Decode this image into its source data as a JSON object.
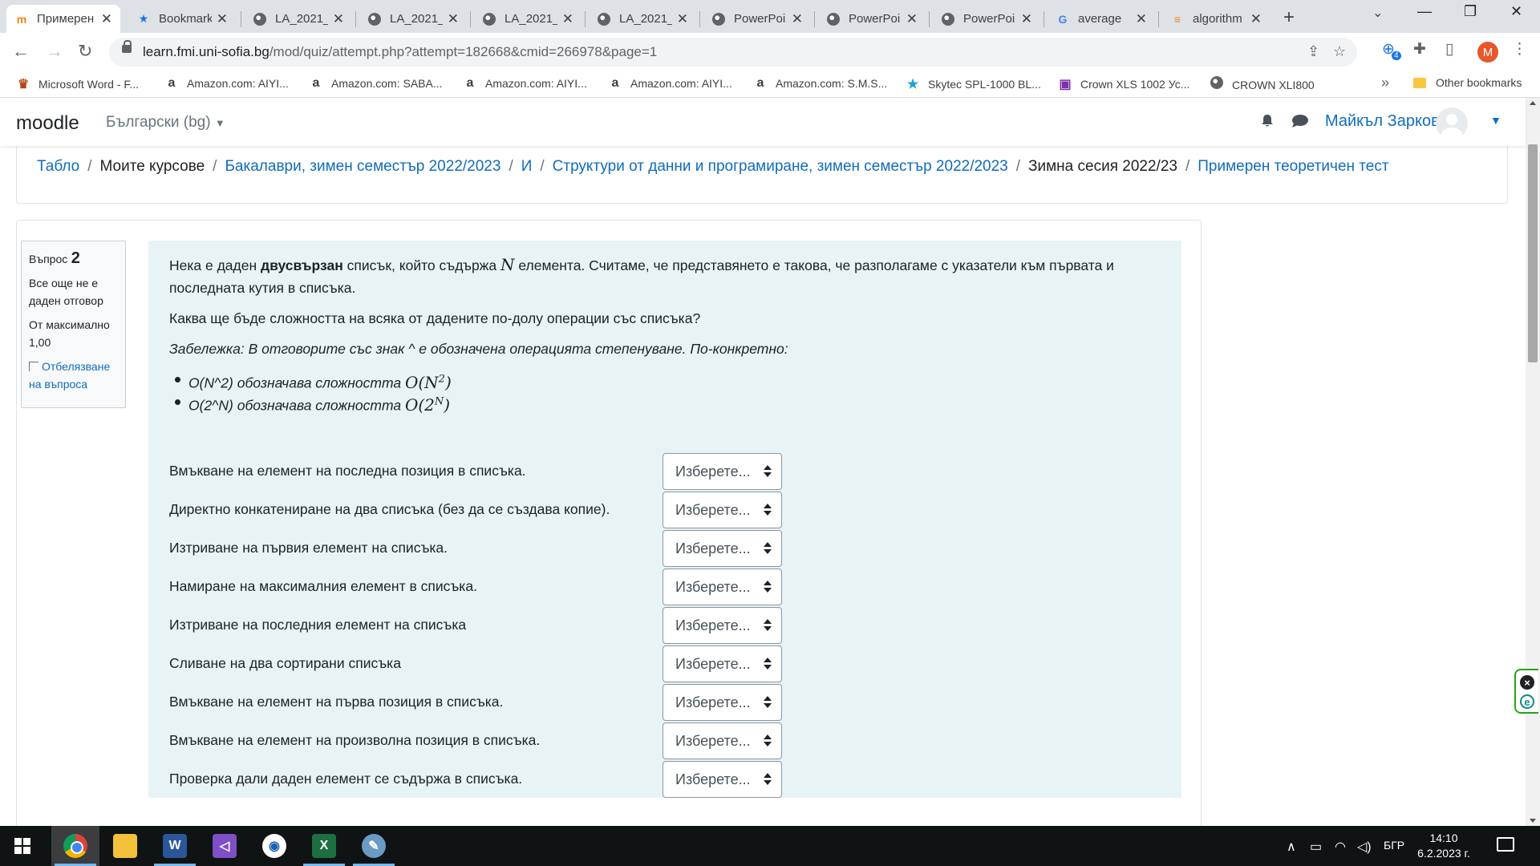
{
  "tabs": [
    {
      "title": "Примерен",
      "favicon": "moodle-icon",
      "active": true
    },
    {
      "title": "Bookmarks",
      "favicon": "star-icon"
    },
    {
      "title": "LA_2021_",
      "favicon": "globe-icon"
    },
    {
      "title": "LA_2021_",
      "favicon": "globe-icon"
    },
    {
      "title": "LA_2021_",
      "favicon": "globe-icon"
    },
    {
      "title": "LA_2021_",
      "favicon": "globe-icon"
    },
    {
      "title": "PowerPoi",
      "favicon": "globe-icon"
    },
    {
      "title": "PowerPoi",
      "favicon": "globe-icon"
    },
    {
      "title": "PowerPoi",
      "favicon": "globe-icon"
    },
    {
      "title": "average",
      "favicon": "google-icon"
    },
    {
      "title": "algorithm",
      "favicon": "stackoverflow-icon"
    }
  ],
  "browser": {
    "url_host": "learn.fmi.uni-sofia.bg",
    "url_path": "/mod/quiz/attempt.php?attempt=182668&cmid=266978&page=1",
    "profile_initial": "M",
    "extension_badge": "4"
  },
  "bookmarks": [
    {
      "label": "Microsoft Word - F...",
      "icon": "crown-icon"
    },
    {
      "label": "Amazon.com: AIYI...",
      "icon": "amazon-icon"
    },
    {
      "label": "Amazon.com: SABA...",
      "icon": "amazon-icon"
    },
    {
      "label": "Amazon.com: AIYI...",
      "icon": "amazon-icon"
    },
    {
      "label": "Amazon.com: AIYI...",
      "icon": "amazon-icon"
    },
    {
      "label": "Amazon.com: S.M.S...",
      "icon": "amazon-icon"
    },
    {
      "label": "Skytec SPL-1000 BL...",
      "icon": "star-icon"
    },
    {
      "label": "Crown XLS 1002 Ус...",
      "icon": "purple-icon"
    },
    {
      "label": "CROWN XLI800",
      "icon": "globe-icon"
    }
  ],
  "bookmarks_other": "Other bookmarks",
  "moodle": {
    "brand": "moodle",
    "language": "Български (bg)",
    "username": "Майкъл Зарков"
  },
  "breadcrumb": [
    {
      "label": "Табло",
      "link": true
    },
    {
      "label": "Моите курсове",
      "link": false
    },
    {
      "label": "Бакалаври, зимен семестър 2022/2023",
      "link": true
    },
    {
      "label": "И",
      "link": true
    },
    {
      "label": "Структури от данни и програмиране, зимен семестър 2022/2023",
      "link": true
    },
    {
      "label": "Зимна сесия 2022/23",
      "link": false
    },
    {
      "label": "Примерен теоретичен тест",
      "link": true
    }
  ],
  "question_info": {
    "label": "Въпрос",
    "number": "2",
    "state": "Все още не е даден отговор",
    "grade": "От максимално 1,00",
    "flag": "Отбелязване на въпроса"
  },
  "question": {
    "intro_before": "Нека е даден ",
    "intro_bold": "двусвързан",
    "intro_mid": " списък, който съдържа ",
    "intro_var": "N",
    "intro_after": " елемента. Считаме, че представянето е такова, че разполагаме с указатели към първата и последната кутия в списъка.",
    "prompt": "Каква ще бъде сложността на всяка от дадените по-долу операции със списъка?",
    "note": "Забележка: В отговорите със знак ^ е обозначена операцията степенуване. По-конкретно:",
    "bullet1_text": "O(N^2) обозначава сложността ",
    "bullet1_base": "O(N",
    "bullet1_exp": "2",
    "bullet2_text": "O(2^N) обозначава сложността ",
    "bullet2_base": "O(2",
    "bullet2_exp": "N",
    "close_paren": ")",
    "select_placeholder": "Изберете...",
    "rows": [
      "Вмъкване на елемент на последна позиция в списъка.",
      "Директно конкатениране на два списъка (без да се създава копие).",
      "Изтриване на първия елемент на списъка.",
      "Намиране на максималния елемент в списъка.",
      "Изтриване на последния елемент на списъка",
      "Сливане на два сортирани списъка",
      "Вмъкване на елемент на първа позиция в списъка.",
      "Вмъкване на елемент на произволна позиция в списъка.",
      "Проверка дали даден елемент се съдържа в списъка."
    ]
  },
  "taskbar": {
    "language": "БГР",
    "time": "14:10",
    "date": "6.2.2023 г."
  },
  "colors": {
    "link": "#0f6cbf",
    "question_bg": "#e7f3f5",
    "taskbar": "#101314"
  }
}
